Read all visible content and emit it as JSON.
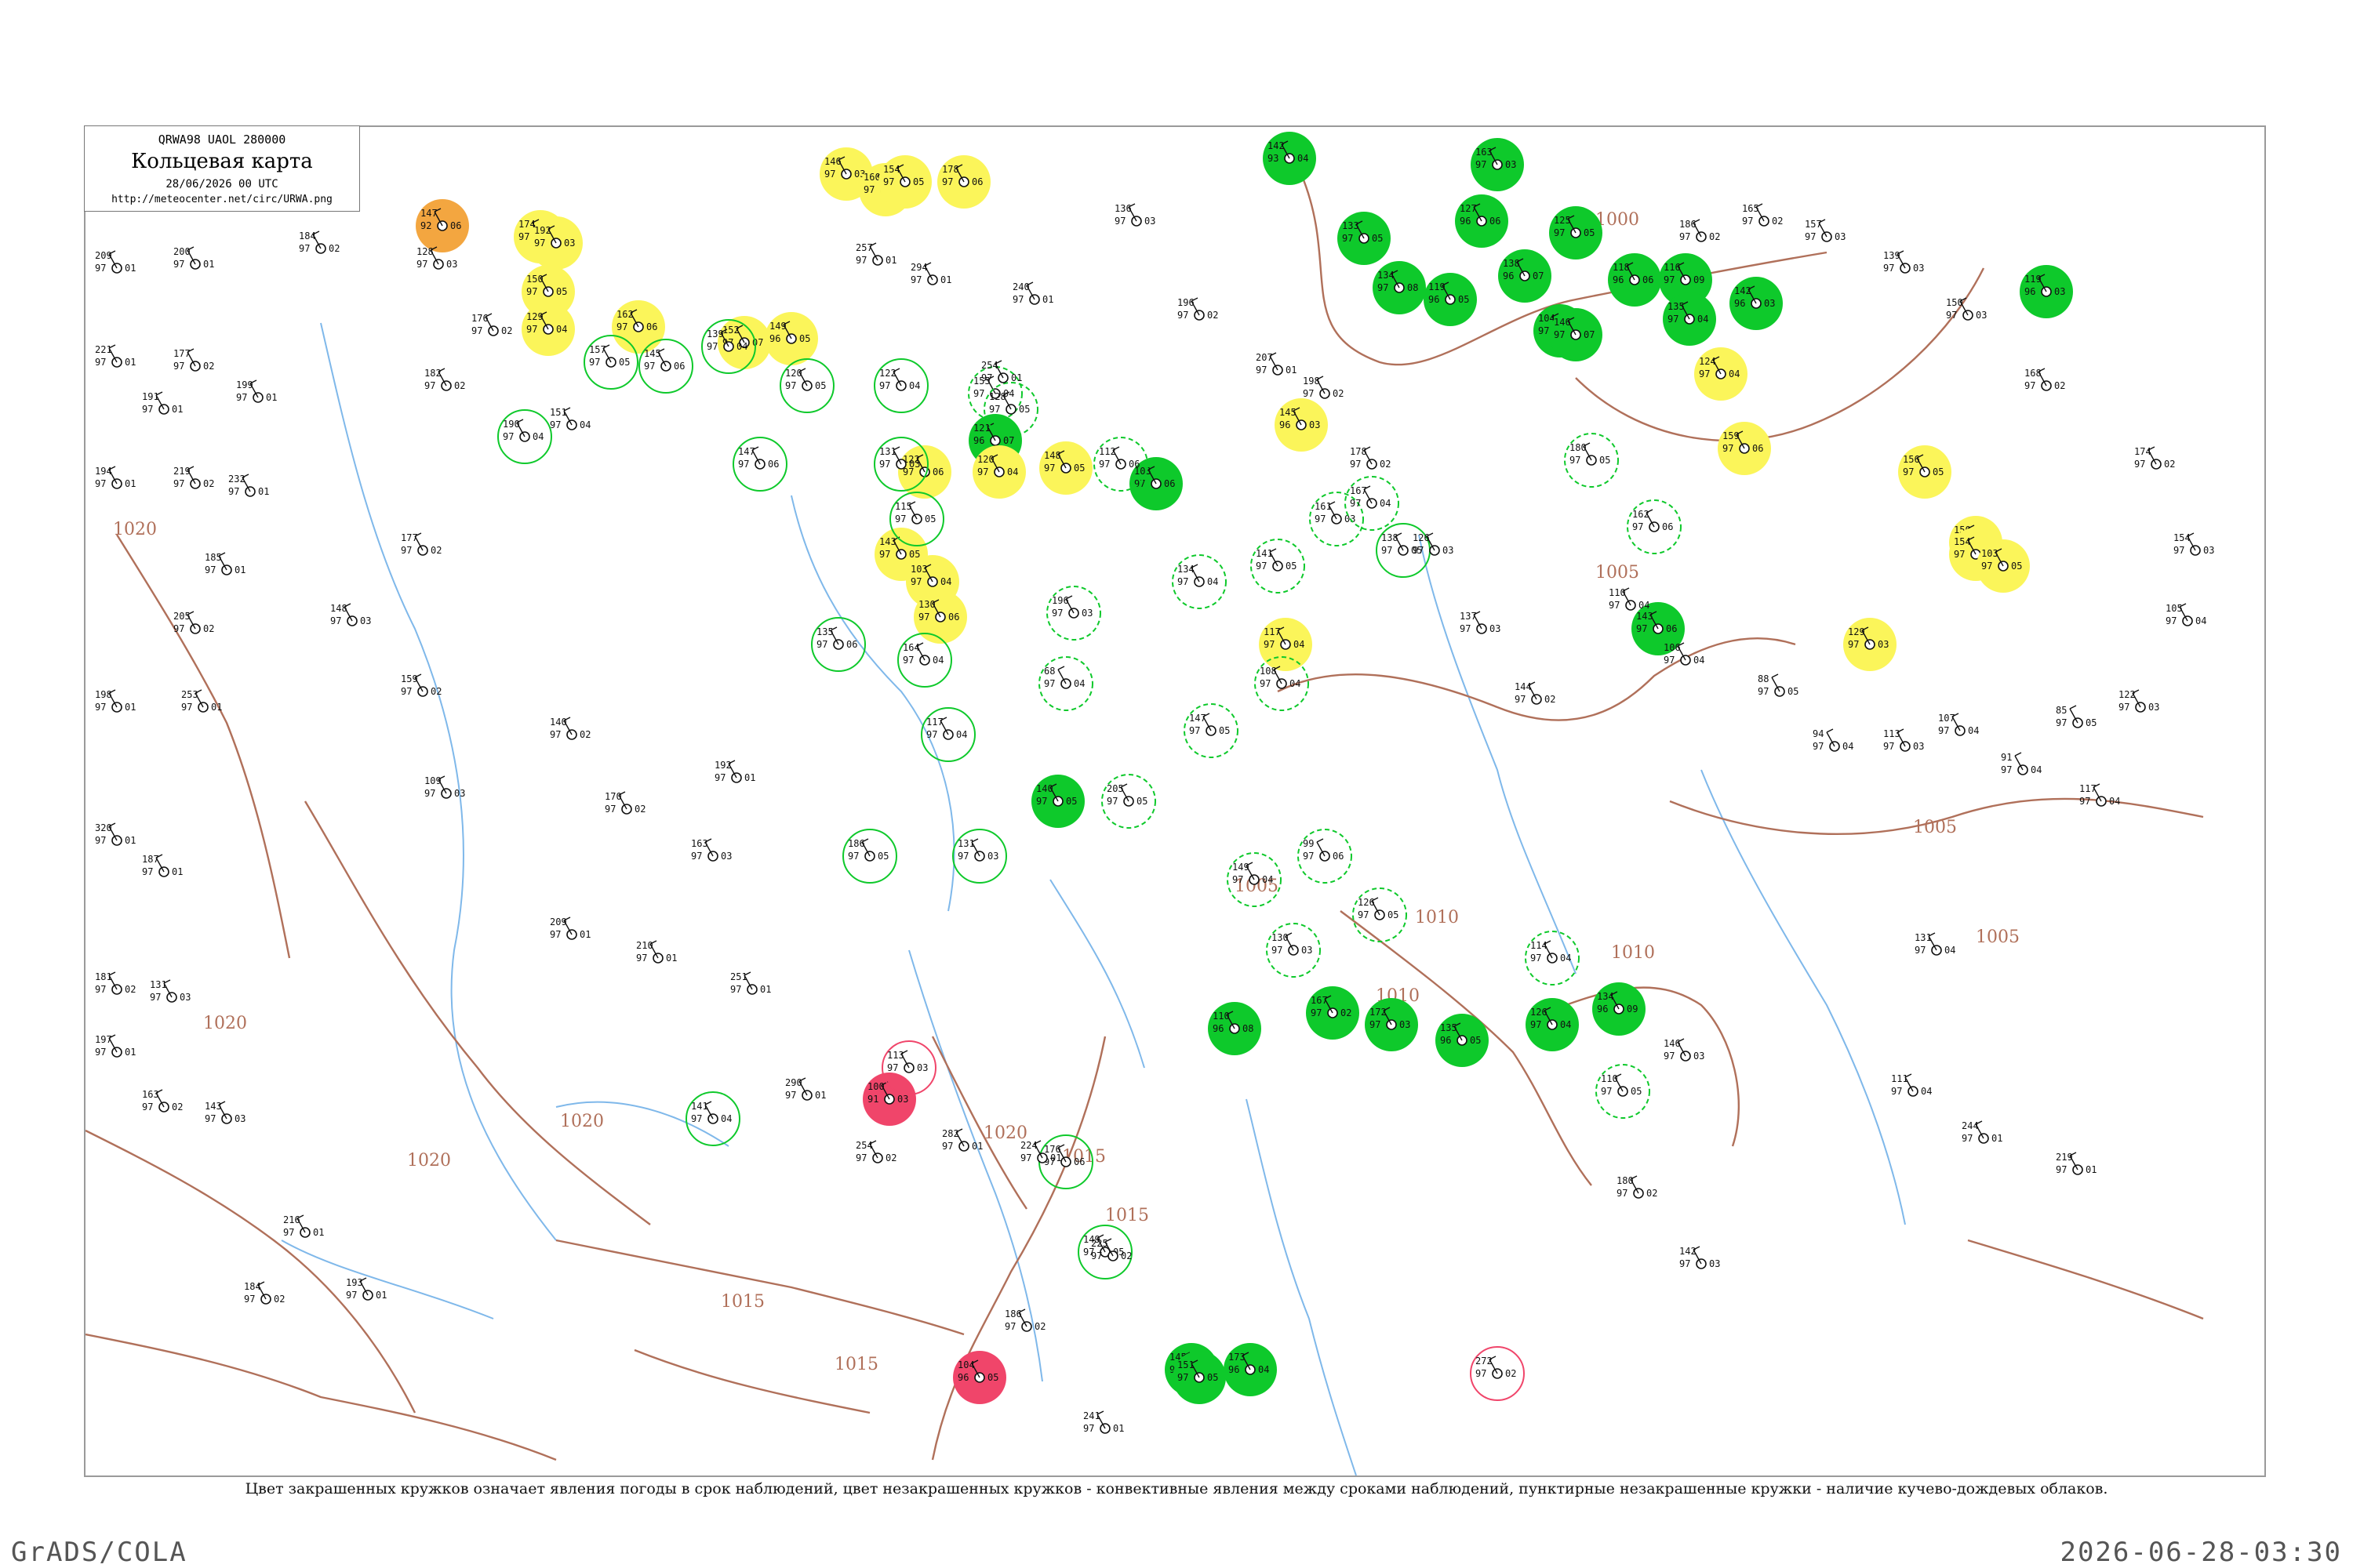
{
  "title": {
    "code": "QRWA98  UAOL  280000",
    "main": "Кольцевая карта",
    "time": "28/06/2026 00 UTC",
    "url": "http://meteocenter.net/circ/URWA.png"
  },
  "caption": "Цвет закрашенных кружков означает явления погоды в срок наблюдений, цвет незакрашенных кружков - конвективные явления между сроками наблюдений, пунктирные незакрашенные кружки - наличие кучево-дождевых облаков.",
  "footer": {
    "left": "GrADS/COLA",
    "right": "2026-06-28-03:30"
  },
  "colors": {
    "thunder": "#0ec92b",
    "rain": "#fbf55a",
    "shower": "#ffd23f",
    "hail": "#f0456a",
    "dust": "#f3a640",
    "isobar": "#b0705a",
    "river": "#7fb8ea",
    "frame": "#9a9a9a"
  },
  "isobar_labels": [
    "1000",
    "1005",
    "1005",
    "1005",
    "1005",
    "1010",
    "1010",
    "1010",
    "1015",
    "1015",
    "1015",
    "1015",
    "1020",
    "1020",
    "1020",
    "1020",
    "1020"
  ],
  "stations": {
    "filled_green": [
      {
        "a": "142",
        "b": "93",
        "c": "04"
      },
      {
        "a": "133",
        "b": "97",
        "c": "05"
      },
      {
        "a": "134",
        "b": "97",
        "c": "08"
      },
      {
        "a": "163",
        "b": "97",
        "c": "03"
      },
      {
        "a": "138",
        "b": "96",
        "c": "07"
      },
      {
        "a": "127",
        "b": "96",
        "c": "06"
      },
      {
        "a": "125",
        "b": "97",
        "c": "05"
      },
      {
        "a": "119",
        "b": "96",
        "c": "05"
      },
      {
        "a": "104",
        "b": "97",
        "c": "08"
      },
      {
        "a": "118",
        "b": "96",
        "c": "06"
      },
      {
        "a": "116",
        "b": "97",
        "c": "09"
      },
      {
        "a": "142",
        "b": "96",
        "c": "03"
      },
      {
        "a": "135",
        "b": "97",
        "c": "04"
      },
      {
        "a": "121",
        "b": "96",
        "c": "07"
      },
      {
        "a": "103",
        "b": "97",
        "c": "06"
      },
      {
        "a": "110",
        "b": "96",
        "c": "08"
      },
      {
        "a": "167",
        "b": "97",
        "c": "02"
      },
      {
        "a": "172",
        "b": "97",
        "c": "03"
      },
      {
        "a": "135",
        "b": "96",
        "c": "05"
      },
      {
        "a": "126",
        "b": "97",
        "c": "04"
      },
      {
        "a": "134",
        "b": "96",
        "c": "09"
      },
      {
        "a": "145",
        "b": "97",
        "c": "06"
      },
      {
        "a": "151",
        "b": "97",
        "c": "05"
      },
      {
        "a": "173",
        "b": "96",
        "c": "04"
      },
      {
        "a": "146",
        "b": "97",
        "c": "07"
      },
      {
        "a": "143",
        "b": "97",
        "c": "06"
      },
      {
        "a": "119",
        "b": "96",
        "c": "03"
      },
      {
        "a": "140",
        "b": "97",
        "c": "05"
      }
    ],
    "filled_yellow": [
      {
        "a": "146",
        "b": "97",
        "c": "03"
      },
      {
        "a": "160",
        "b": "97",
        "c": "04"
      },
      {
        "a": "154",
        "b": "97",
        "c": "05"
      },
      {
        "a": "178",
        "b": "97",
        "c": "06"
      },
      {
        "a": "174",
        "b": "97",
        "c": "04"
      },
      {
        "a": "192",
        "b": "97",
        "c": "03"
      },
      {
        "a": "150",
        "b": "97",
        "c": "05"
      },
      {
        "a": "129",
        "b": "97",
        "c": "04"
      },
      {
        "a": "162",
        "b": "97",
        "c": "06"
      },
      {
        "a": "152",
        "b": "97",
        "c": "07"
      },
      {
        "a": "149",
        "b": "96",
        "c": "05"
      },
      {
        "a": "120",
        "b": "97",
        "c": "04"
      },
      {
        "a": "122",
        "b": "97",
        "c": "06"
      },
      {
        "a": "143",
        "b": "97",
        "c": "05"
      },
      {
        "a": "103",
        "b": "97",
        "c": "04"
      },
      {
        "a": "130",
        "b": "97",
        "c": "06"
      },
      {
        "a": "145",
        "b": "96",
        "c": "03"
      },
      {
        "a": "148",
        "b": "97",
        "c": "05"
      },
      {
        "a": "124",
        "b": "97",
        "c": "04"
      },
      {
        "a": "159",
        "b": "97",
        "c": "06"
      },
      {
        "a": "156",
        "b": "97",
        "c": "05"
      },
      {
        "a": "150",
        "b": "97",
        "c": "04"
      },
      {
        "a": "154",
        "b": "97",
        "c": "06"
      },
      {
        "a": "103",
        "b": "97",
        "c": "05"
      },
      {
        "a": "117",
        "b": "97",
        "c": "04"
      },
      {
        "a": "129",
        "b": "97",
        "c": "03"
      }
    ],
    "filled_orange": [
      {
        "a": "147",
        "b": "92",
        "c": "06"
      }
    ],
    "filled_red": [
      {
        "a": "100",
        "b": "91",
        "c": "03"
      },
      {
        "a": "104",
        "b": "96",
        "c": "05"
      }
    ],
    "open_green": [
      {
        "a": "190",
        "b": "97",
        "c": "04"
      },
      {
        "a": "157",
        "b": "97",
        "c": "05"
      },
      {
        "a": "145",
        "b": "97",
        "c": "06"
      },
      {
        "a": "139",
        "b": "97",
        "c": "04"
      },
      {
        "a": "147",
        "b": "97",
        "c": "06"
      },
      {
        "a": "120",
        "b": "97",
        "c": "05"
      },
      {
        "a": "131",
        "b": "97",
        "c": "03"
      },
      {
        "a": "122",
        "b": "97",
        "c": "04"
      },
      {
        "a": "115",
        "b": "97",
        "c": "05"
      },
      {
        "a": "135",
        "b": "97",
        "c": "06"
      },
      {
        "a": "164",
        "b": "97",
        "c": "04"
      },
      {
        "a": "186",
        "b": "97",
        "c": "05"
      },
      {
        "a": "131",
        "b": "97",
        "c": "03"
      },
      {
        "a": "117",
        "b": "97",
        "c": "04"
      },
      {
        "a": "149",
        "b": "97",
        "c": "05"
      },
      {
        "a": "176",
        "b": "97",
        "c": "06"
      },
      {
        "a": "141",
        "b": "97",
        "c": "04"
      },
      {
        "a": "138",
        "b": "97",
        "c": "05"
      }
    ],
    "open_dashed": [
      {
        "a": "155",
        "b": "97",
        "c": "04"
      },
      {
        "a": "128",
        "b": "97",
        "c": "05"
      },
      {
        "a": "112",
        "b": "97",
        "c": "06"
      },
      {
        "a": "134",
        "b": "97",
        "c": "04"
      },
      {
        "a": "141",
        "b": "97",
        "c": "05"
      },
      {
        "a": "161",
        "b": "97",
        "c": "03"
      },
      {
        "a": "167",
        "b": "97",
        "c": "04"
      },
      {
        "a": "180",
        "b": "97",
        "c": "05"
      },
      {
        "a": "162",
        "b": "97",
        "c": "06"
      },
      {
        "a": "108",
        "b": "97",
        "c": "04"
      },
      {
        "a": "147",
        "b": "97",
        "c": "05"
      },
      {
        "a": "196",
        "b": "97",
        "c": "03"
      },
      {
        "a": "68",
        "b": "97",
        "c": "04"
      },
      {
        "a": "205",
        "b": "97",
        "c": "05"
      },
      {
        "a": "99",
        "b": "97",
        "c": "06"
      },
      {
        "a": "149",
        "b": "97",
        "c": "04"
      },
      {
        "a": "126",
        "b": "97",
        "c": "05"
      },
      {
        "a": "130",
        "b": "97",
        "c": "03"
      },
      {
        "a": "114",
        "b": "97",
        "c": "04"
      },
      {
        "a": "110",
        "b": "97",
        "c": "05"
      }
    ],
    "open_red": [
      {
        "a": "272",
        "b": "97",
        "c": "02"
      },
      {
        "a": "113",
        "b": "97",
        "c": "03"
      }
    ],
    "plain": [
      {
        "a": "209",
        "b": "97",
        "c": "01"
      },
      {
        "a": "200",
        "b": "97",
        "c": "01"
      },
      {
        "a": "184",
        "b": "97",
        "c": "02"
      },
      {
        "a": "221",
        "b": "97",
        "c": "01"
      },
      {
        "a": "177",
        "b": "97",
        "c": "02"
      },
      {
        "a": "199",
        "b": "97",
        "c": "01"
      },
      {
        "a": "191",
        "b": "97",
        "c": "01"
      },
      {
        "a": "194",
        "b": "97",
        "c": "01"
      },
      {
        "a": "219",
        "b": "97",
        "c": "02"
      },
      {
        "a": "232",
        "b": "97",
        "c": "01"
      },
      {
        "a": "185",
        "b": "97",
        "c": "01"
      },
      {
        "a": "205",
        "b": "97",
        "c": "02"
      },
      {
        "a": "198",
        "b": "97",
        "c": "01"
      },
      {
        "a": "253",
        "b": "97",
        "c": "01"
      },
      {
        "a": "320",
        "b": "97",
        "c": "01"
      },
      {
        "a": "187",
        "b": "97",
        "c": "01"
      },
      {
        "a": "181",
        "b": "97",
        "c": "02"
      },
      {
        "a": "131",
        "b": "97",
        "c": "03"
      },
      {
        "a": "197",
        "b": "97",
        "c": "01"
      },
      {
        "a": "163",
        "b": "97",
        "c": "02"
      },
      {
        "a": "143",
        "b": "97",
        "c": "03"
      },
      {
        "a": "216",
        "b": "97",
        "c": "01"
      },
      {
        "a": "184",
        "b": "97",
        "c": "02"
      },
      {
        "a": "193",
        "b": "97",
        "c": "01"
      },
      {
        "a": "128",
        "b": "97",
        "c": "03"
      },
      {
        "a": "182",
        "b": "97",
        "c": "02"
      },
      {
        "a": "176",
        "b": "97",
        "c": "02"
      },
      {
        "a": "151",
        "b": "97",
        "c": "04"
      },
      {
        "a": "177",
        "b": "97",
        "c": "02"
      },
      {
        "a": "148",
        "b": "97",
        "c": "03"
      },
      {
        "a": "159",
        "b": "97",
        "c": "02"
      },
      {
        "a": "109",
        "b": "97",
        "c": "03"
      },
      {
        "a": "140",
        "b": "97",
        "c": "02"
      },
      {
        "a": "170",
        "b": "97",
        "c": "02"
      },
      {
        "a": "192",
        "b": "97",
        "c": "01"
      },
      {
        "a": "163",
        "b": "97",
        "c": "03"
      },
      {
        "a": "209",
        "b": "97",
        "c": "01"
      },
      {
        "a": "210",
        "b": "97",
        "c": "01"
      },
      {
        "a": "251",
        "b": "97",
        "c": "01"
      },
      {
        "a": "290",
        "b": "97",
        "c": "01"
      },
      {
        "a": "254",
        "b": "97",
        "c": "02"
      },
      {
        "a": "282",
        "b": "97",
        "c": "01"
      },
      {
        "a": "224",
        "b": "97",
        "c": "01"
      },
      {
        "a": "225",
        "b": "97",
        "c": "02"
      },
      {
        "a": "186",
        "b": "97",
        "c": "02"
      },
      {
        "a": "241",
        "b": "97",
        "c": "01"
      },
      {
        "a": "146",
        "b": "97",
        "c": "03"
      },
      {
        "a": "180",
        "b": "97",
        "c": "02"
      },
      {
        "a": "142",
        "b": "97",
        "c": "03"
      },
      {
        "a": "240",
        "b": "97",
        "c": "01"
      },
      {
        "a": "254",
        "b": "97",
        "c": "01"
      },
      {
        "a": "294",
        "b": "97",
        "c": "01"
      },
      {
        "a": "257",
        "b": "97",
        "c": "01"
      },
      {
        "a": "136",
        "b": "97",
        "c": "03"
      },
      {
        "a": "196",
        "b": "97",
        "c": "02"
      },
      {
        "a": "207",
        "b": "97",
        "c": "01"
      },
      {
        "a": "198",
        "b": "97",
        "c": "02"
      },
      {
        "a": "178",
        "b": "97",
        "c": "02"
      },
      {
        "a": "126",
        "b": "97",
        "c": "03"
      },
      {
        "a": "137",
        "b": "97",
        "c": "03"
      },
      {
        "a": "144",
        "b": "97",
        "c": "02"
      },
      {
        "a": "110",
        "b": "97",
        "c": "04"
      },
      {
        "a": "106",
        "b": "97",
        "c": "04"
      },
      {
        "a": "88",
        "b": "97",
        "c": "05"
      },
      {
        "a": "94",
        "b": "97",
        "c": "04"
      },
      {
        "a": "113",
        "b": "97",
        "c": "03"
      },
      {
        "a": "107",
        "b": "97",
        "c": "04"
      },
      {
        "a": "91",
        "b": "97",
        "c": "04"
      },
      {
        "a": "85",
        "b": "97",
        "c": "05"
      },
      {
        "a": "117",
        "b": "97",
        "c": "04"
      },
      {
        "a": "122",
        "b": "97",
        "c": "03"
      },
      {
        "a": "105",
        "b": "97",
        "c": "04"
      },
      {
        "a": "154",
        "b": "97",
        "c": "03"
      },
      {
        "a": "174",
        "b": "97",
        "c": "02"
      },
      {
        "a": "168",
        "b": "97",
        "c": "02"
      },
      {
        "a": "150",
        "b": "97",
        "c": "03"
      },
      {
        "a": "139",
        "b": "97",
        "c": "03"
      },
      {
        "a": "157",
        "b": "97",
        "c": "03"
      },
      {
        "a": "165",
        "b": "97",
        "c": "02"
      },
      {
        "a": "186",
        "b": "97",
        "c": "02"
      },
      {
        "a": "131",
        "b": "97",
        "c": "04"
      },
      {
        "a": "111",
        "b": "97",
        "c": "04"
      },
      {
        "a": "244",
        "b": "97",
        "c": "01"
      },
      {
        "a": "219",
        "b": "97",
        "c": "01"
      }
    ]
  }
}
